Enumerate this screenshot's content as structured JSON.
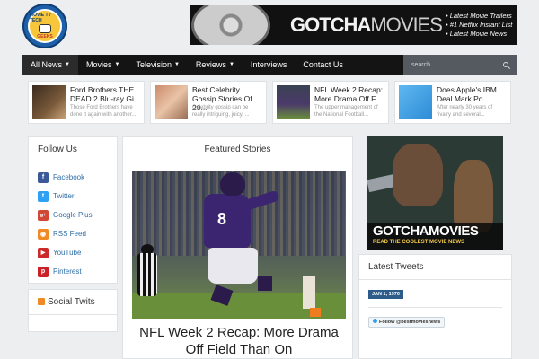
{
  "header": {
    "logo": {
      "top_text": "MOVIE TV TECH",
      "bottom_text": "GEEKS"
    },
    "banner": {
      "brand_part1": "GOTCHA",
      "brand_part2": "MOVIES",
      "bullets": [
        "• Latest Movie Trailers",
        "• #1 Netflix Instant List",
        "• Latest Movie News"
      ]
    }
  },
  "nav": {
    "items": [
      {
        "label": "All News",
        "dropdown": true
      },
      {
        "label": "Movies",
        "dropdown": true
      },
      {
        "label": "Television",
        "dropdown": true
      },
      {
        "label": "Reviews",
        "dropdown": true
      },
      {
        "label": "Interviews",
        "dropdown": false
      },
      {
        "label": "Contact Us",
        "dropdown": false
      }
    ],
    "caret": "▼",
    "search_placeholder": "search..."
  },
  "top_stories": [
    {
      "title": "Ford Brothers THE DEAD 2 Blu-ray Gi...",
      "excerpt": "Those Ford Brothers have done it again with another..."
    },
    {
      "title": "Best Celebrity Gossip Stories Of 20...",
      "excerpt": "Celebrity gossip can be really intriguing, juicy, ..."
    },
    {
      "title": "NFL Week 2 Recap: More Drama Off F...",
      "excerpt": "The upper management of the National Football..."
    },
    {
      "title": "Does Apple's IBM Deal Mark Po...",
      "excerpt": "After nearly 30 years of rivalry and several..."
    }
  ],
  "follow_us": {
    "title": "Follow Us",
    "items": [
      {
        "label": "Facebook",
        "glyph": "f",
        "color": "#3b5998",
        "icon": "facebook-icon"
      },
      {
        "label": "Twitter",
        "glyph": "t",
        "color": "#2ea1f2",
        "icon": "twitter-icon"
      },
      {
        "label": "Google Plus",
        "glyph": "g+",
        "color": "#d14836",
        "icon": "google-plus-icon"
      },
      {
        "label": "RSS Feed",
        "glyph": "◉",
        "color": "#f08a24",
        "icon": "rss-icon"
      },
      {
        "label": "YouTube",
        "glyph": "▶",
        "color": "#cc2a2a",
        "icon": "youtube-icon"
      },
      {
        "label": "Pinterest",
        "glyph": "p",
        "color": "#cb2027",
        "icon": "pinterest-icon"
      }
    ]
  },
  "social_twits": {
    "title": "Social Twits"
  },
  "featured": {
    "heading": "Featured Stories",
    "caption": "NFL Week 2 Recap: More Drama Off Field Than On",
    "jersey_number": "8"
  },
  "ad": {
    "title": "GOTCHAMOVIES",
    "subtitle": "READ THE COOLEST MOVIE NEWS"
  },
  "tweets": {
    "title": "Latest Tweets",
    "date": "JAN 1, 1970",
    "follow_label": "Follow @bestmoviesnews"
  },
  "colors": {
    "nav_bg": "#141414",
    "link": "#2e6ea6",
    "accent": "#2e5c8a"
  }
}
